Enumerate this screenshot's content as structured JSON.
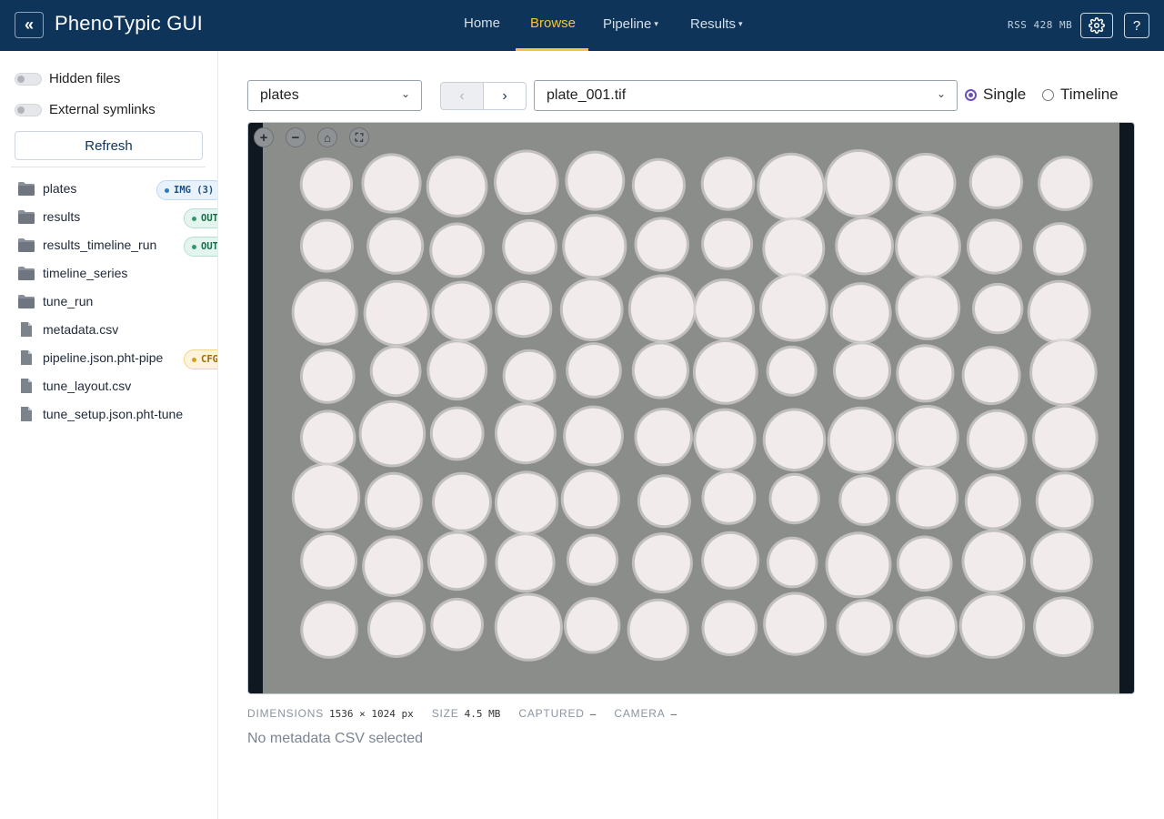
{
  "app": {
    "title": "PhenoTypic GUI",
    "collapse_glyph": "«",
    "rss_label": "RSS 428 MB"
  },
  "nav": [
    {
      "label": "Home",
      "active": false
    },
    {
      "label": "Browse",
      "active": true
    },
    {
      "label": "Pipeline",
      "dropdown": true
    },
    {
      "label": "Results",
      "dropdown": true
    }
  ],
  "header_buttons": {
    "settings_icon": "gear-icon",
    "help_label": "?"
  },
  "sidebar": {
    "toggles": [
      {
        "label": "Hidden files",
        "on": false
      },
      {
        "label": "External symlinks",
        "on": false
      }
    ],
    "refresh_label": "Refresh",
    "files": [
      {
        "name": "plates",
        "type": "folder",
        "badge": "IMG (3)",
        "badge_kind": "img"
      },
      {
        "name": "results",
        "type": "folder",
        "badge": "OUT",
        "badge_kind": "out"
      },
      {
        "name": "results_timeline_run",
        "type": "folder",
        "badge": "OUT",
        "badge_kind": "out"
      },
      {
        "name": "timeline_series",
        "type": "folder"
      },
      {
        "name": "tune_run",
        "type": "folder"
      },
      {
        "name": "metadata.csv",
        "type": "file"
      },
      {
        "name": "pipeline.json.pht-pipe",
        "type": "file",
        "badge": "CFG",
        "badge_kind": "cfg"
      },
      {
        "name": "tune_layout.csv",
        "type": "file"
      },
      {
        "name": "tune_setup.json.pht-tune",
        "type": "file"
      }
    ]
  },
  "main": {
    "folder_select": "plates",
    "prev_glyph": "‹",
    "next_glyph": "›",
    "file_select": "plate_001.tif",
    "view_modes": [
      {
        "label": "Single",
        "selected": true
      },
      {
        "label": "Timeline",
        "selected": false
      }
    ],
    "viewer_tools": [
      {
        "icon": "zoom-in-icon",
        "glyph": "+"
      },
      {
        "icon": "zoom-out-icon",
        "glyph": "−"
      },
      {
        "icon": "home-icon",
        "glyph": "⌂"
      },
      {
        "icon": "fullscreen-icon",
        "glyph": "⛶"
      }
    ],
    "plate": {
      "rows": 8,
      "cols": 12
    },
    "metadata": [
      {
        "key": "DIMENSIONS",
        "value": "1536 × 1024 px"
      },
      {
        "key": "SIZE",
        "value": "4.5 MB"
      },
      {
        "key": "CAPTURED",
        "value": "—"
      },
      {
        "key": "CAMERA",
        "value": "—"
      }
    ],
    "no_metadata_text": "No metadata CSV selected"
  },
  "colors": {
    "topbar": "#0e3459",
    "active_nav": "#f6c343",
    "radio_accent": "#6b4fbb",
    "plate_bg": "#8a8d89",
    "colony": "#f1eceb"
  }
}
